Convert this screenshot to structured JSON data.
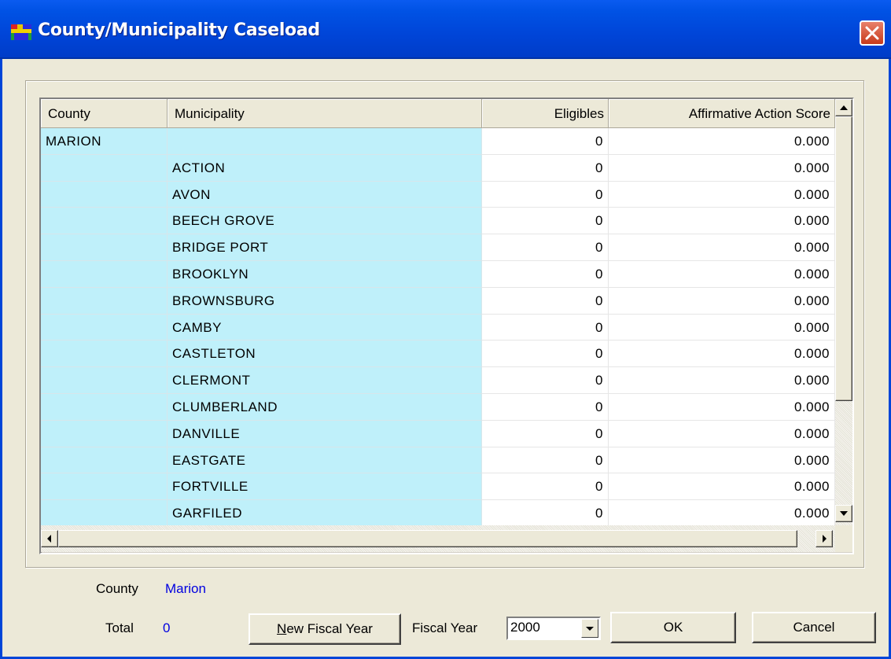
{
  "window": {
    "title": "County/Municipality Caseload"
  },
  "grid": {
    "columns": [
      "County",
      "Municipality",
      "Eligibles",
      "Affirmative Action Score"
    ],
    "rows": [
      {
        "county": "MARION",
        "municipality": "",
        "eligibles": "0",
        "score": "0.000"
      },
      {
        "county": "",
        "municipality": "ACTION",
        "eligibles": "0",
        "score": "0.000"
      },
      {
        "county": "",
        "municipality": "AVON",
        "eligibles": "0",
        "score": "0.000"
      },
      {
        "county": "",
        "municipality": "BEECH GROVE",
        "eligibles": "0",
        "score": "0.000"
      },
      {
        "county": "",
        "municipality": "BRIDGE PORT",
        "eligibles": "0",
        "score": "0.000"
      },
      {
        "county": "",
        "municipality": "BROOKLYN",
        "eligibles": "0",
        "score": "0.000"
      },
      {
        "county": "",
        "municipality": "BROWNSBURG",
        "eligibles": "0",
        "score": "0.000"
      },
      {
        "county": "",
        "municipality": "CAMBY",
        "eligibles": "0",
        "score": "0.000"
      },
      {
        "county": "",
        "municipality": "CASTLETON",
        "eligibles": "0",
        "score": "0.000"
      },
      {
        "county": "",
        "municipality": "CLERMONT",
        "eligibles": "0",
        "score": "0.000"
      },
      {
        "county": "",
        "municipality": "CLUMBERLAND",
        "eligibles": "0",
        "score": "0.000"
      },
      {
        "county": "",
        "municipality": "DANVILLE",
        "eligibles": "0",
        "score": "0.000"
      },
      {
        "county": "",
        "municipality": "EASTGATE",
        "eligibles": "0",
        "score": "0.000"
      },
      {
        "county": "",
        "municipality": "FORTVILLE",
        "eligibles": "0",
        "score": "0.000"
      },
      {
        "county": "",
        "municipality": "GARFILED",
        "eligibles": "0",
        "score": "0.000"
      }
    ]
  },
  "summary": {
    "county_label": "County",
    "county_value": "Marion",
    "total_label": "Total",
    "total_value": "0"
  },
  "buttons": {
    "new_fiscal_year_mnemonic": "N",
    "new_fiscal_year_rest": "ew Fiscal Year",
    "ok": "OK",
    "cancel": "Cancel"
  },
  "fiscal_year": {
    "label": "Fiscal Year",
    "value": "2000"
  },
  "colors": {
    "row_highlight": "#BFF0FA",
    "value_text": "#0000E0",
    "titlebar": "#0045D8"
  }
}
